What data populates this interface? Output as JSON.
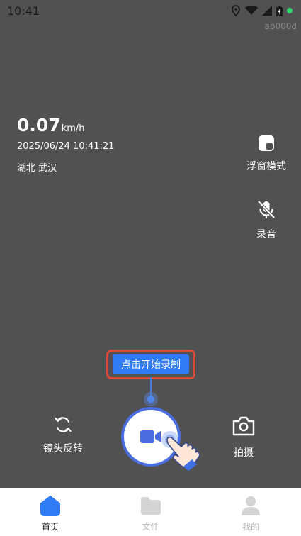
{
  "status_bar": {
    "time": "10:41",
    "icons": [
      "location-icon",
      "wifi-icon",
      "signal-icon",
      "battery-icon",
      "notification-dot"
    ]
  },
  "device_id": "ab000d",
  "speed": {
    "value": "0.07",
    "unit": "km/h",
    "datetime": "2025/06/24 10:41:21",
    "location": "湖北 武汉"
  },
  "side_controls": {
    "float_mode_label": "浮窗模式",
    "audio_label": "录音"
  },
  "hint": {
    "text": "点击开始录制"
  },
  "controls": {
    "flip_label": "镜头反转",
    "photo_label": "拍摄"
  },
  "nav": {
    "items": [
      {
        "label": "首页",
        "icon": "home-icon",
        "active": true
      },
      {
        "label": "文件",
        "icon": "folder-icon",
        "active": false
      },
      {
        "label": "我的",
        "icon": "user-icon",
        "active": false
      }
    ]
  },
  "colors": {
    "background": "#515151",
    "accent": "#2f7cf6",
    "record_ring": "#4a6ee0",
    "hint_border": "#d94a3a",
    "nav_active": "#2f7cf6",
    "nav_inactive": "#cfcfcf"
  }
}
